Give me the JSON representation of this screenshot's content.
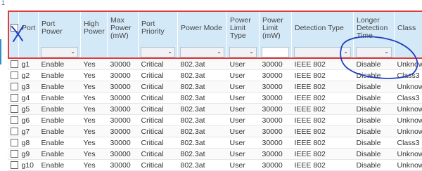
{
  "marker": "1",
  "columns": [
    "Port",
    "Port Power",
    "High Power",
    "Max Power (mW)",
    "Port Priority",
    "Power Mode",
    "Power Limit Type",
    "Power Limit (mW)",
    "Detection Type",
    "Longer Detection Time",
    "Class"
  ],
  "filters": {
    "power_dropdown": "",
    "priority_dropdown": "",
    "mode_dropdown": "",
    "limit_type_dropdown": "",
    "limit_value": "",
    "detection_dropdown": "",
    "longer_dropdown": ""
  },
  "rows": [
    {
      "port": "g1",
      "port_power": "Enable",
      "high_power": "Yes",
      "max_power": "30000",
      "priority": "Critical",
      "mode": "802.3at",
      "limit_type": "User",
      "limit": "30000",
      "detection": "IEEE 802",
      "longer": "Disable",
      "class": "Unknown"
    },
    {
      "port": "g2",
      "port_power": "Enable",
      "high_power": "Yes",
      "max_power": "30000",
      "priority": "Critical",
      "mode": "802.3at",
      "limit_type": "User",
      "limit": "30000",
      "detection": "IEEE 802",
      "longer": "Disable",
      "class": "Class3"
    },
    {
      "port": "g3",
      "port_power": "Enable",
      "high_power": "Yes",
      "max_power": "30000",
      "priority": "Critical",
      "mode": "802.3at",
      "limit_type": "User",
      "limit": "30000",
      "detection": "IEEE 802",
      "longer": "Disable",
      "class": "Unknown"
    },
    {
      "port": "g4",
      "port_power": "Enable",
      "high_power": "Yes",
      "max_power": "30000",
      "priority": "Critical",
      "mode": "802.3at",
      "limit_type": "User",
      "limit": "30000",
      "detection": "IEEE 802",
      "longer": "Disable",
      "class": "Class3"
    },
    {
      "port": "g5",
      "port_power": "Enable",
      "high_power": "Yes",
      "max_power": "30000",
      "priority": "Critical",
      "mode": "802.3at",
      "limit_type": "User",
      "limit": "30000",
      "detection": "IEEE 802",
      "longer": "Disable",
      "class": "Unknown"
    },
    {
      "port": "g6",
      "port_power": "Enable",
      "high_power": "Yes",
      "max_power": "30000",
      "priority": "Critical",
      "mode": "802.3at",
      "limit_type": "User",
      "limit": "30000",
      "detection": "IEEE 802",
      "longer": "Disable",
      "class": "Unknown"
    },
    {
      "port": "g7",
      "port_power": "Enable",
      "high_power": "Yes",
      "max_power": "30000",
      "priority": "Critical",
      "mode": "802.3at",
      "limit_type": "User",
      "limit": "30000",
      "detection": "IEEE 802",
      "longer": "Disable",
      "class": "Unknown"
    },
    {
      "port": "g8",
      "port_power": "Enable",
      "high_power": "Yes",
      "max_power": "30000",
      "priority": "Critical",
      "mode": "802.3at",
      "limit_type": "User",
      "limit": "30000",
      "detection": "IEEE 802",
      "longer": "Disable",
      "class": "Class3"
    },
    {
      "port": "g9",
      "port_power": "Enable",
      "high_power": "Yes",
      "max_power": "30000",
      "priority": "Critical",
      "mode": "802.3at",
      "limit_type": "User",
      "limit": "30000",
      "detection": "IEEE 802",
      "longer": "Disable",
      "class": "Unknown"
    },
    {
      "port": "g10",
      "port_power": "Enable",
      "high_power": "Yes",
      "max_power": "30000",
      "priority": "Critical",
      "mode": "802.3at",
      "limit_type": "User",
      "limit": "30000",
      "detection": "IEEE 802",
      "longer": "Disable",
      "class": "Unknown"
    }
  ],
  "icons": {
    "dropdown": "chevron-down-icon",
    "row_select": "checkbox-icon"
  },
  "colors": {
    "header_bg": "#d4e9f7",
    "highlight_box": "#e03c3c",
    "ink_annotation": "#1f3fbf"
  }
}
